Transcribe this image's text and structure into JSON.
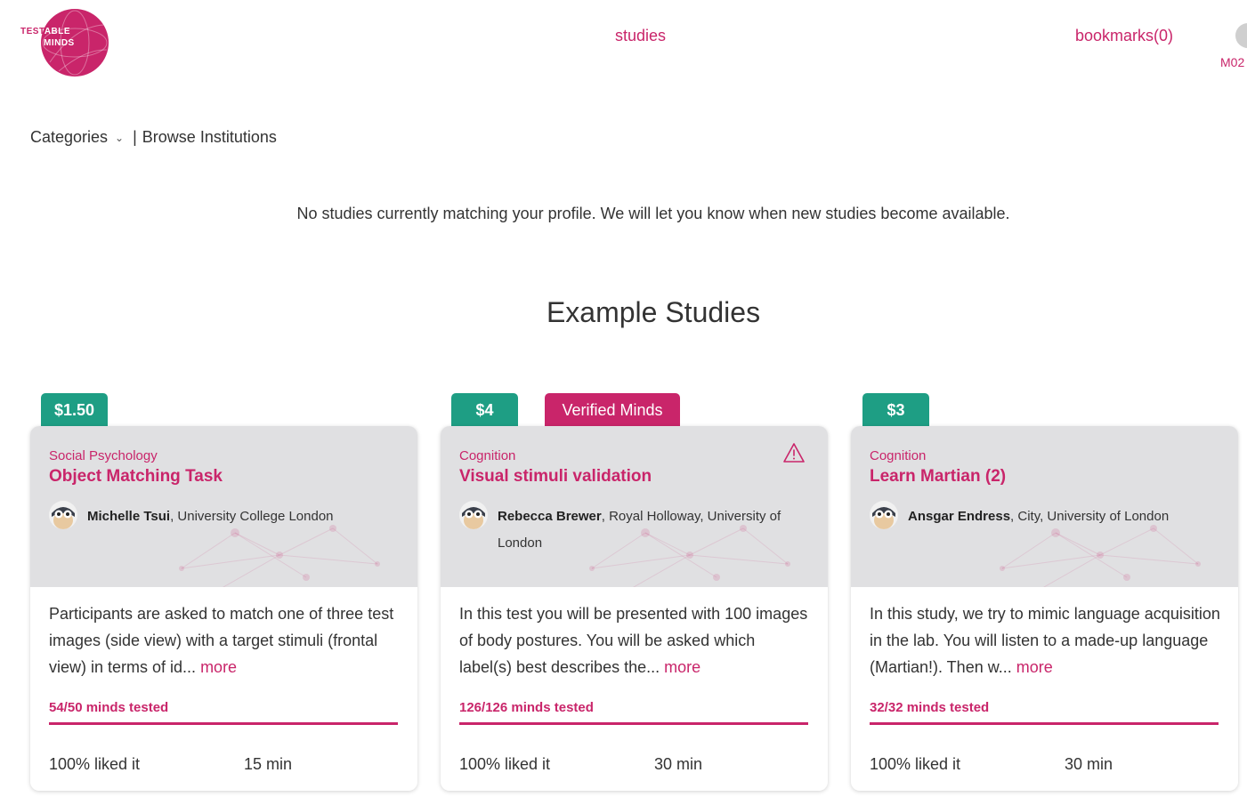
{
  "header": {
    "logo_text_1a": "TEST",
    "logo_text_1b": "ABLE",
    "logo_text_2": "MINDS",
    "nav_studies": "studies",
    "nav_bookmarks": "bookmarks(0)",
    "user_code": "M02"
  },
  "filters": {
    "categories": "Categories",
    "separator": "|",
    "browse": "Browse Institutions"
  },
  "message": "No studies currently matching your profile. We will let you know when new studies become available.",
  "section_title": "Example Studies",
  "colors": {
    "brand": "#c9256a",
    "price_tag": "#1e9e84",
    "card_header_bg": "#e0e0e2"
  },
  "cards": [
    {
      "price": "$1.50",
      "category": "Social Psychology",
      "title": "Object Matching Task",
      "researcher_name": "Michelle Tsui",
      "institution": ", University College London",
      "description": "Participants are asked to match one of three test images (side view) with a target stimuli (frontal view) in terms of id...",
      "more": "more",
      "tested": "54/50 minds tested",
      "progress": 1.0,
      "liked": "100% liked it",
      "duration": "15 min"
    },
    {
      "price": "$4",
      "badge": "Verified Minds",
      "warning_icon": "warning-triangle-icon",
      "category": "Cognition",
      "title": "Visual stimuli validation",
      "researcher_name": "Rebecca Brewer",
      "institution": ", Royal Holloway, University of London",
      "description": "In this test you will be presented with 100 images of body postures. You will be asked which label(s) best describes the...",
      "more": "more",
      "tested": "126/126 minds tested",
      "progress": 1.0,
      "liked": "100% liked it",
      "duration": "30 min"
    },
    {
      "price": "$3",
      "category": "Cognition",
      "title": "Learn Martian (2)",
      "researcher_name": "Ansgar Endress",
      "institution": ", City, University of London",
      "description": "In this study, we try to mimic language acquisition in the lab. You will listen to a made-up language (Martian!). Then w...",
      "more": "more",
      "tested": "32/32 minds tested",
      "progress": 1.0,
      "liked": "100% liked it",
      "duration": "30 min"
    }
  ]
}
